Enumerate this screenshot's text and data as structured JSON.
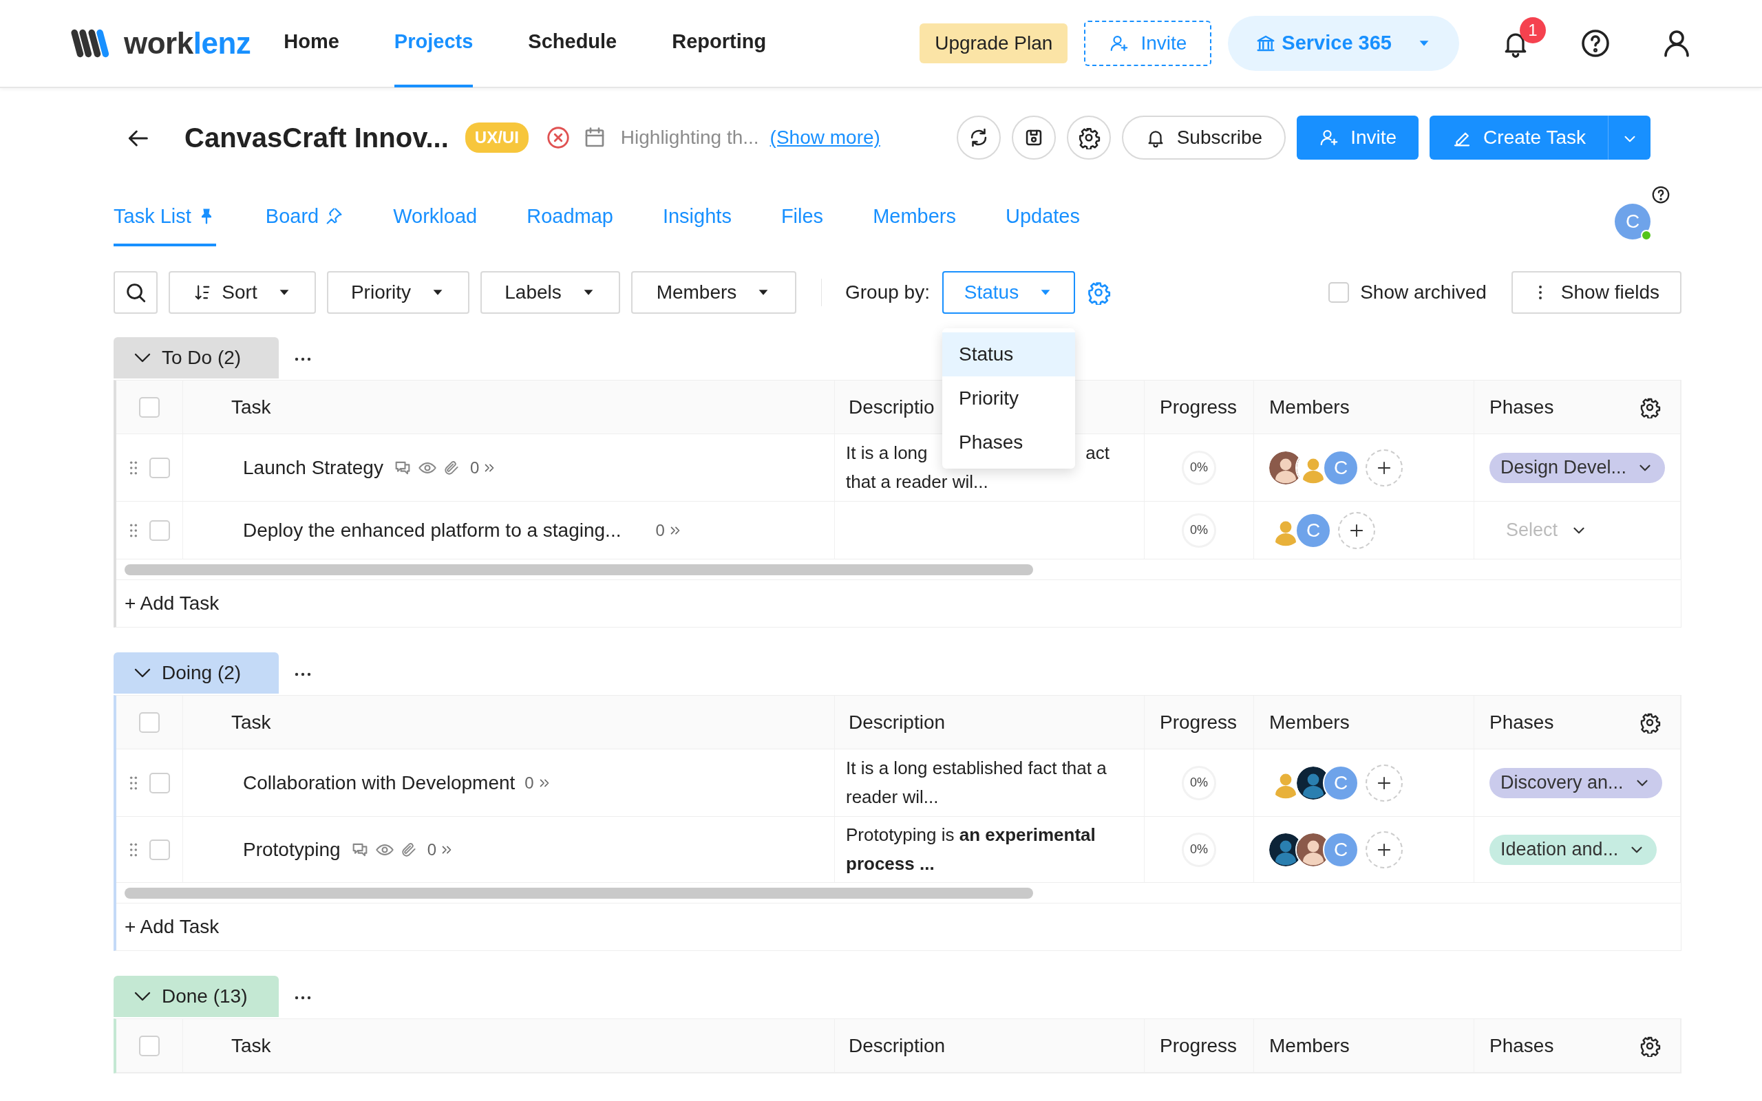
{
  "navbar": {
    "logo": [
      "work",
      "lenz"
    ],
    "items": [
      {
        "label": "Home",
        "selected": false
      },
      {
        "label": "Projects",
        "selected": true
      },
      {
        "label": "Schedule",
        "selected": false
      },
      {
        "label": "Reporting",
        "selected": false
      }
    ],
    "upgrade": "Upgrade Plan",
    "invite": "Invite",
    "workspace": "Service 365",
    "notifications": "1"
  },
  "project": {
    "title": "CanvasCraft Innov...",
    "category": "UX/UI",
    "description": "Highlighting th...",
    "show_more": "(Show more)",
    "subscribe": "Subscribe",
    "invite": "Invite",
    "create_task": "Create Task"
  },
  "tabs": [
    {
      "label": "Task List",
      "selected": true,
      "pinned": true
    },
    {
      "label": "Board",
      "selected": false,
      "pinned": false
    },
    {
      "label": "Workload",
      "selected": false
    },
    {
      "label": "Roadmap",
      "selected": false
    },
    {
      "label": "Insights",
      "selected": false
    },
    {
      "label": "Files",
      "selected": false
    },
    {
      "label": "Members",
      "selected": false
    },
    {
      "label": "Updates",
      "selected": false
    }
  ],
  "user_avatar": {
    "initial": "C",
    "online": true
  },
  "toolbar": {
    "filters": [
      {
        "kind": "sort",
        "label": "Sort"
      },
      {
        "kind": "dropdown",
        "label": "Priority"
      },
      {
        "kind": "dropdown",
        "label": "Labels"
      },
      {
        "kind": "dropdown",
        "label": "Members"
      }
    ],
    "group_by_label": "Group by:",
    "group_by": {
      "value": "Status",
      "expanded": true,
      "options": [
        {
          "label": "Status",
          "selected": true
        },
        {
          "label": "Priority",
          "selected": false
        },
        {
          "label": "Phases",
          "selected": false
        }
      ]
    },
    "show_archived": {
      "label": "Show archived",
      "checked": false
    },
    "show_fields": "Show fields"
  },
  "groups": [
    {
      "name": "To Do (2)",
      "color": "#dedede",
      "all_checked": false,
      "columns": [
        "Task",
        "Descriptio",
        "Progress",
        "Members",
        "Phases"
      ],
      "tasks": [
        {
          "name": "Launch Strategy",
          "checked": false,
          "icons": true,
          "subtasks": "0",
          "description_fragments": [
            "It is a long",
            "act",
            "that a reader wil..."
          ],
          "progress": "0%",
          "members": [
            {
              "kind": "silhouette"
            },
            {
              "kind": "silhouette"
            },
            {
              "kind": "initial",
              "initial": "C"
            }
          ],
          "phase": {
            "label": "Design Devel...",
            "color": "#cacbec"
          }
        },
        {
          "name": "Deploy the enhanced platform to a staging...",
          "checked": false,
          "icons": false,
          "subtasks": "0",
          "progress": "0%",
          "members": [
            {
              "kind": "silhouette"
            },
            {
              "kind": "initial",
              "initial": "C"
            }
          ],
          "phase": {
            "placeholder": "Select"
          }
        }
      ],
      "add_task": "+ Add Task"
    },
    {
      "name": "Doing (2)",
      "color": "#c4daf7",
      "all_checked": false,
      "columns": [
        "Task",
        "Description",
        "Progress",
        "Members",
        "Phases"
      ],
      "tasks": [
        {
          "name": "Collaboration with Development",
          "checked": false,
          "icons": false,
          "subtasks": "0",
          "description": "It is a long established fact that a reader wil...",
          "progress": "0%",
          "members": [
            {
              "kind": "silhouette"
            },
            {
              "kind": "silhouette"
            },
            {
              "kind": "initial",
              "initial": "C"
            }
          ],
          "phase": {
            "label": "Discovery an...",
            "color": "#cacbec"
          }
        },
        {
          "name": "Prototyping",
          "checked": false,
          "icons": true,
          "subtasks": "0",
          "description": "Prototyping is **an experimental process ...**",
          "progress": "0%",
          "members": [
            {
              "kind": "silhouette"
            },
            {
              "kind": "silhouette"
            },
            {
              "kind": "initial",
              "initial": "C"
            }
          ],
          "phase": {
            "label": "Ideation and...",
            "color": "#c6ece1"
          }
        }
      ],
      "add_task": "+ Add Task"
    },
    {
      "name": "Done (13)",
      "color": "#c4e8d3",
      "all_checked": false,
      "columns": [
        "Task",
        "Description",
        "Progress",
        "Members",
        "Phases"
      ]
    }
  ]
}
